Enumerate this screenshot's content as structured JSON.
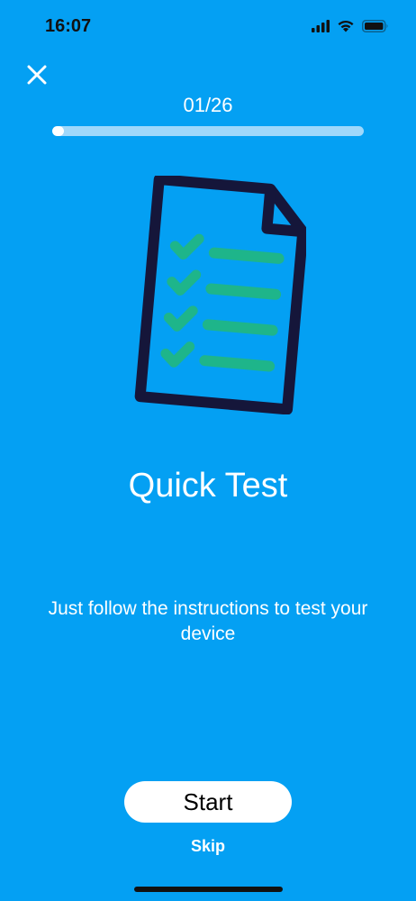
{
  "status_bar": {
    "time": "16:07",
    "icons": [
      "signal-icon",
      "wifi-icon",
      "battery-icon"
    ]
  },
  "header": {
    "close_icon": "close-icon",
    "counter": "01/26",
    "progress_fraction": 0.038
  },
  "illustration": {
    "icon": "checklist-document-icon",
    "colors": {
      "outline": "#15163a",
      "paper": "#04a0f3",
      "check": "#1eb58a"
    }
  },
  "content": {
    "title": "Quick Test",
    "subtitle": "Just follow the instructions to test your device"
  },
  "actions": {
    "start_label": "Start",
    "skip_label": "Skip"
  },
  "colors": {
    "background": "#04a0f3",
    "progress_track": "#9fd8fb",
    "progress_fill": "#ffffff",
    "button_bg": "#ffffff"
  }
}
